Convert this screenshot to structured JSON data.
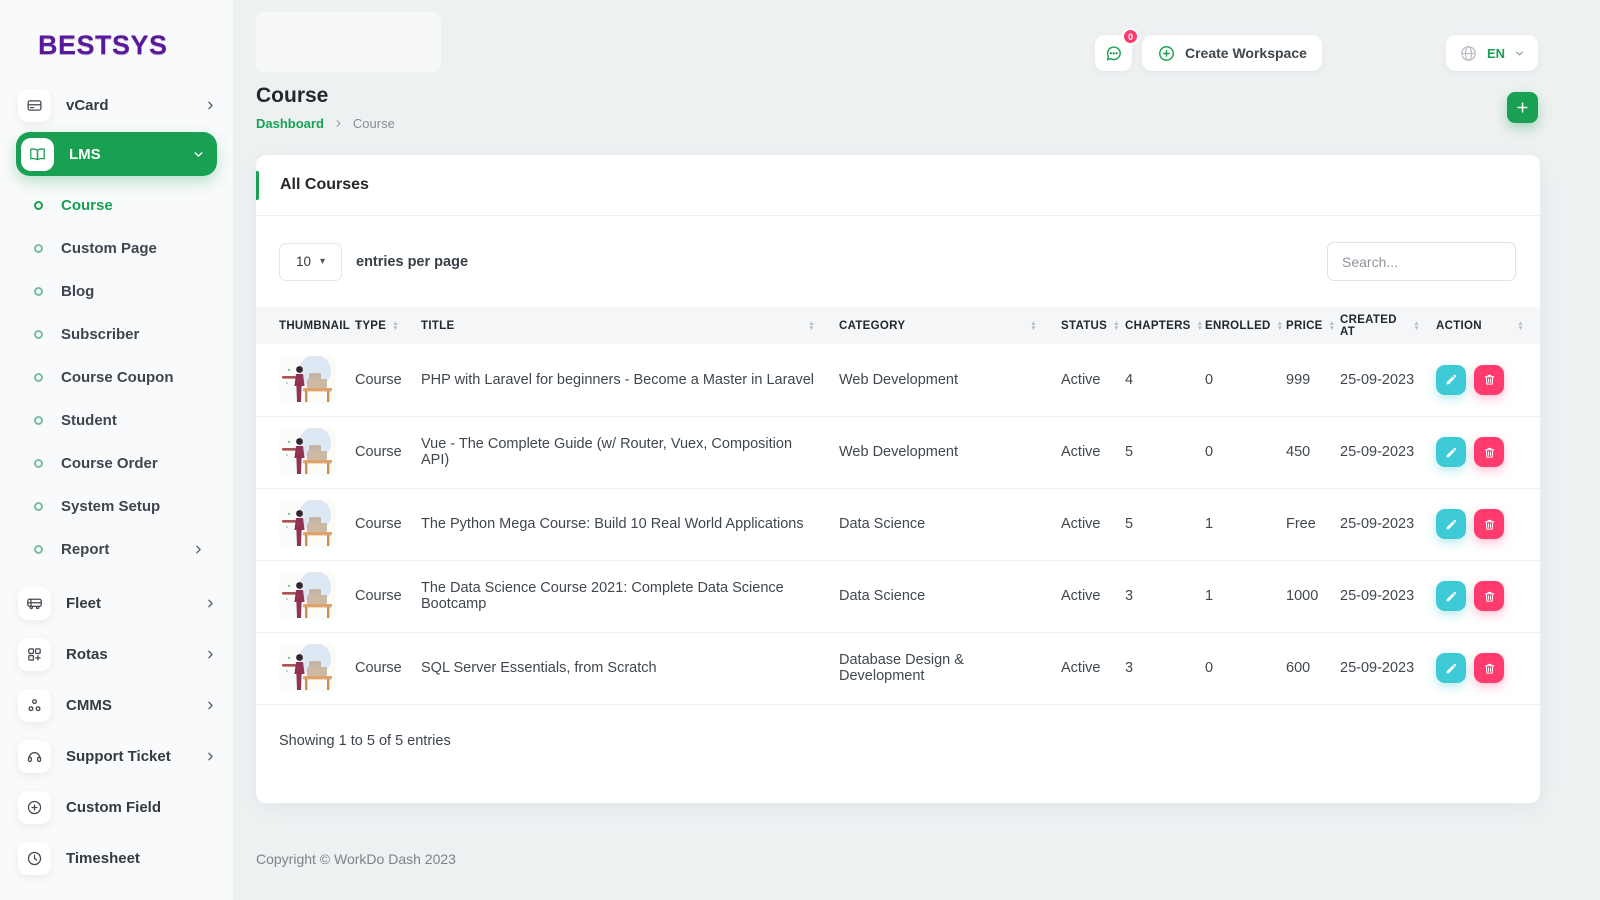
{
  "colors": {
    "primary_green": "#1aa053",
    "info_teal": "#3ec9d6",
    "danger_pink": "#ff3a6e",
    "logo_purple": "#5a189a"
  },
  "brand": {
    "logo_text": "BESTSYS"
  },
  "topbar": {
    "messages_badge": "0",
    "create_workspace_label": "Create Workspace",
    "language_code": "EN"
  },
  "page_header": {
    "title": "Course",
    "breadcrumb_home": "Dashboard",
    "breadcrumb_current": "Course"
  },
  "sidebar": {
    "vcard_label": "vCard",
    "lms_label": "LMS",
    "lms_children": [
      "Course",
      "Custom Page",
      "Blog",
      "Subscriber",
      "Course Coupon",
      "Student",
      "Course Order",
      "System Setup",
      "Report"
    ],
    "bottom_items": [
      "Fleet",
      "Rotas",
      "CMMS",
      "Support Ticket",
      "Custom Field",
      "Timesheet"
    ]
  },
  "card": {
    "title": "All Courses",
    "entries_per_page_value": "10",
    "entries_per_page_label": "entries per page",
    "search_placeholder": "Search...",
    "summary": "Showing 1 to 5 of 5 entries"
  },
  "table": {
    "headers": [
      "Thumbnail",
      "Type",
      "Title",
      "Category",
      "Status",
      "Chapters",
      "Enrolled",
      "Price",
      "Created At",
      "Action"
    ],
    "rows": [
      {
        "type": "Course",
        "title": "PHP with Laravel for beginners - Become a Master in Laravel",
        "category": "Web Development",
        "status": "Active",
        "chapters": "4",
        "enrolled": "0",
        "price": "999",
        "created_at": "25-09-2023"
      },
      {
        "type": "Course",
        "title": "Vue - The Complete Guide (w/ Router, Vuex, Composition API)",
        "category": "Web Development",
        "status": "Active",
        "chapters": "5",
        "enrolled": "0",
        "price": "450",
        "created_at": "25-09-2023"
      },
      {
        "type": "Course",
        "title": "The Python Mega Course: Build 10 Real World Applications",
        "category": "Data Science",
        "status": "Active",
        "chapters": "5",
        "enrolled": "1",
        "price": "Free",
        "created_at": "25-09-2023"
      },
      {
        "type": "Course",
        "title": "The Data Science Course 2021: Complete Data Science Bootcamp",
        "category": "Data Science",
        "status": "Active",
        "chapters": "3",
        "enrolled": "1",
        "price": "1000",
        "created_at": "25-09-2023"
      },
      {
        "type": "Course",
        "title": "SQL Server Essentials, from Scratch",
        "category": "Database Design & Development",
        "status": "Active",
        "chapters": "3",
        "enrolled": "0",
        "price": "600",
        "created_at": "25-09-2023"
      }
    ]
  },
  "footer": {
    "copyright": "Copyright © WorkDo Dash 2023"
  }
}
